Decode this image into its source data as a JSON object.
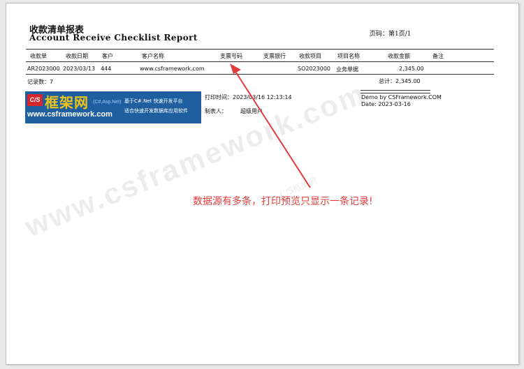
{
  "report": {
    "title_cn": "收款清单报表",
    "title_en": "Account Receive Checklist Report",
    "page_label": "页码：第1页/1"
  },
  "table": {
    "columns": [
      "收款单",
      "收款日期",
      "客户",
      "客户名称",
      "支票号码",
      "支票银行",
      "收款项目",
      "项目名称",
      "收款金额",
      "备注"
    ],
    "rows": [
      [
        "AR2023000",
        "2023/03/13",
        "444",
        "www.csframework.com",
        "",
        "",
        "SO2023000",
        "业务单据",
        "2,345.00",
        ""
      ]
    ]
  },
  "summary": {
    "record_count": "记录数：7",
    "total": "总计：2,345.00"
  },
  "footer": {
    "print_time": "打印时间：2023/03/16 12:13:14",
    "maker": "制表人：",
    "maker_name": "超级用户",
    "demo": "Demo by CSFramework.COM",
    "date": "Date: 2023-03-16"
  },
  "logo": {
    "cs": "C/S",
    "brand": "框架网",
    "sub": "(C#,Asp.Net)",
    "url": "www.csframework.com",
    "tagline1": "基于C#.Net 快速开发平台",
    "tagline2": "适合快速开发数据库应用软件",
    "color_bg": "#1f5f9f",
    "color_brand": "#f0c419",
    "color_cs": "#d8242b"
  },
  "watermark": {
    "text": "www.csframework.com",
    "cn": "C/S框架网"
  },
  "annotation": {
    "text": "数据源有多条，打印预览只显示一条记录!",
    "color": "#e23b3b"
  }
}
